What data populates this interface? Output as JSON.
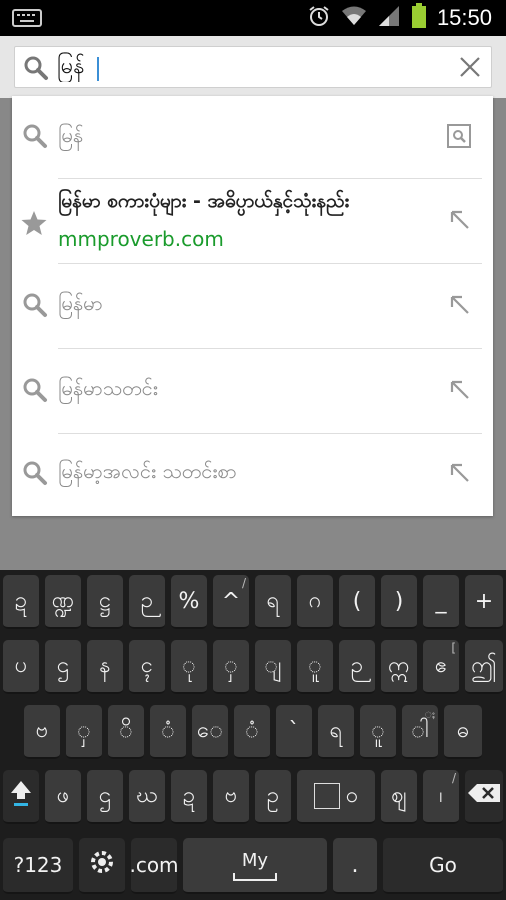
{
  "status_bar": {
    "time": "15:50"
  },
  "search": {
    "query": "မြန်",
    "placeholder": ""
  },
  "suggestions": [
    {
      "text": "မြန်",
      "action": "search"
    },
    {
      "title": "မြန်မာ စကားပုံများ - အဓိပ္ပာယ်နှင့်သုံးနည်း",
      "url": "mmproverb.com",
      "action": "bookmark"
    },
    {
      "text": "မြန်မာ",
      "action": "refine"
    },
    {
      "text": "မြန်မာသတင်း",
      "action": "refine"
    },
    {
      "text": "မြန်မာ့အလင်း သတင်းစာ",
      "action": "refine"
    }
  ],
  "keyboard": {
    "row1": [
      "ဍ",
      "ဏ္ဍ",
      "ဋ္ဌ",
      "ဉ",
      "%",
      "^",
      "ရ",
      "ဂ",
      "(",
      ")",
      "_",
      "+"
    ],
    "row1_hints": [
      "",
      "",
      "",
      "",
      "",
      "/",
      "",
      "",
      "",
      "",
      "",
      ""
    ],
    "row2": [
      "ပ",
      "ဌ",
      "န",
      "ၚ",
      "ု",
      "ှ",
      "ျ",
      "ူ",
      "ဉ",
      "ဣ",
      "ဧ",
      "ဤ"
    ],
    "row2_hints": [
      "",
      "",
      "",
      "",
      "",
      "",
      "",
      "",
      "",
      "",
      "[",
      ""
    ],
    "row3": [
      "ဗ",
      "ှ",
      "ိ",
      "ံ",
      "ေ",
      "ံ",
      "`",
      "ရ",
      "ူ",
      "ါ",
      "ဓ"
    ],
    "row3_hints": [
      "",
      "",
      "",
      "",
      "",
      "",
      "",
      "",
      "",
      "ႈ",
      ""
    ],
    "row4": [
      "ဖ",
      "ဌ",
      "ဃ",
      "ဍ",
      "ဗ",
      "ဥ",
      "ဝ",
      "ဈ",
      "၊"
    ],
    "row4_hints": [
      "",
      "",
      "",
      "",
      "",
      "",
      "",
      "",
      "/"
    ],
    "sym_label": "?123",
    "com_label": ".com",
    "space_label": "My",
    "dot_label": ".",
    "go_label": "Go"
  },
  "colors": {
    "url_green": "#1a9b2c",
    "accent": "#3b8fd6"
  }
}
